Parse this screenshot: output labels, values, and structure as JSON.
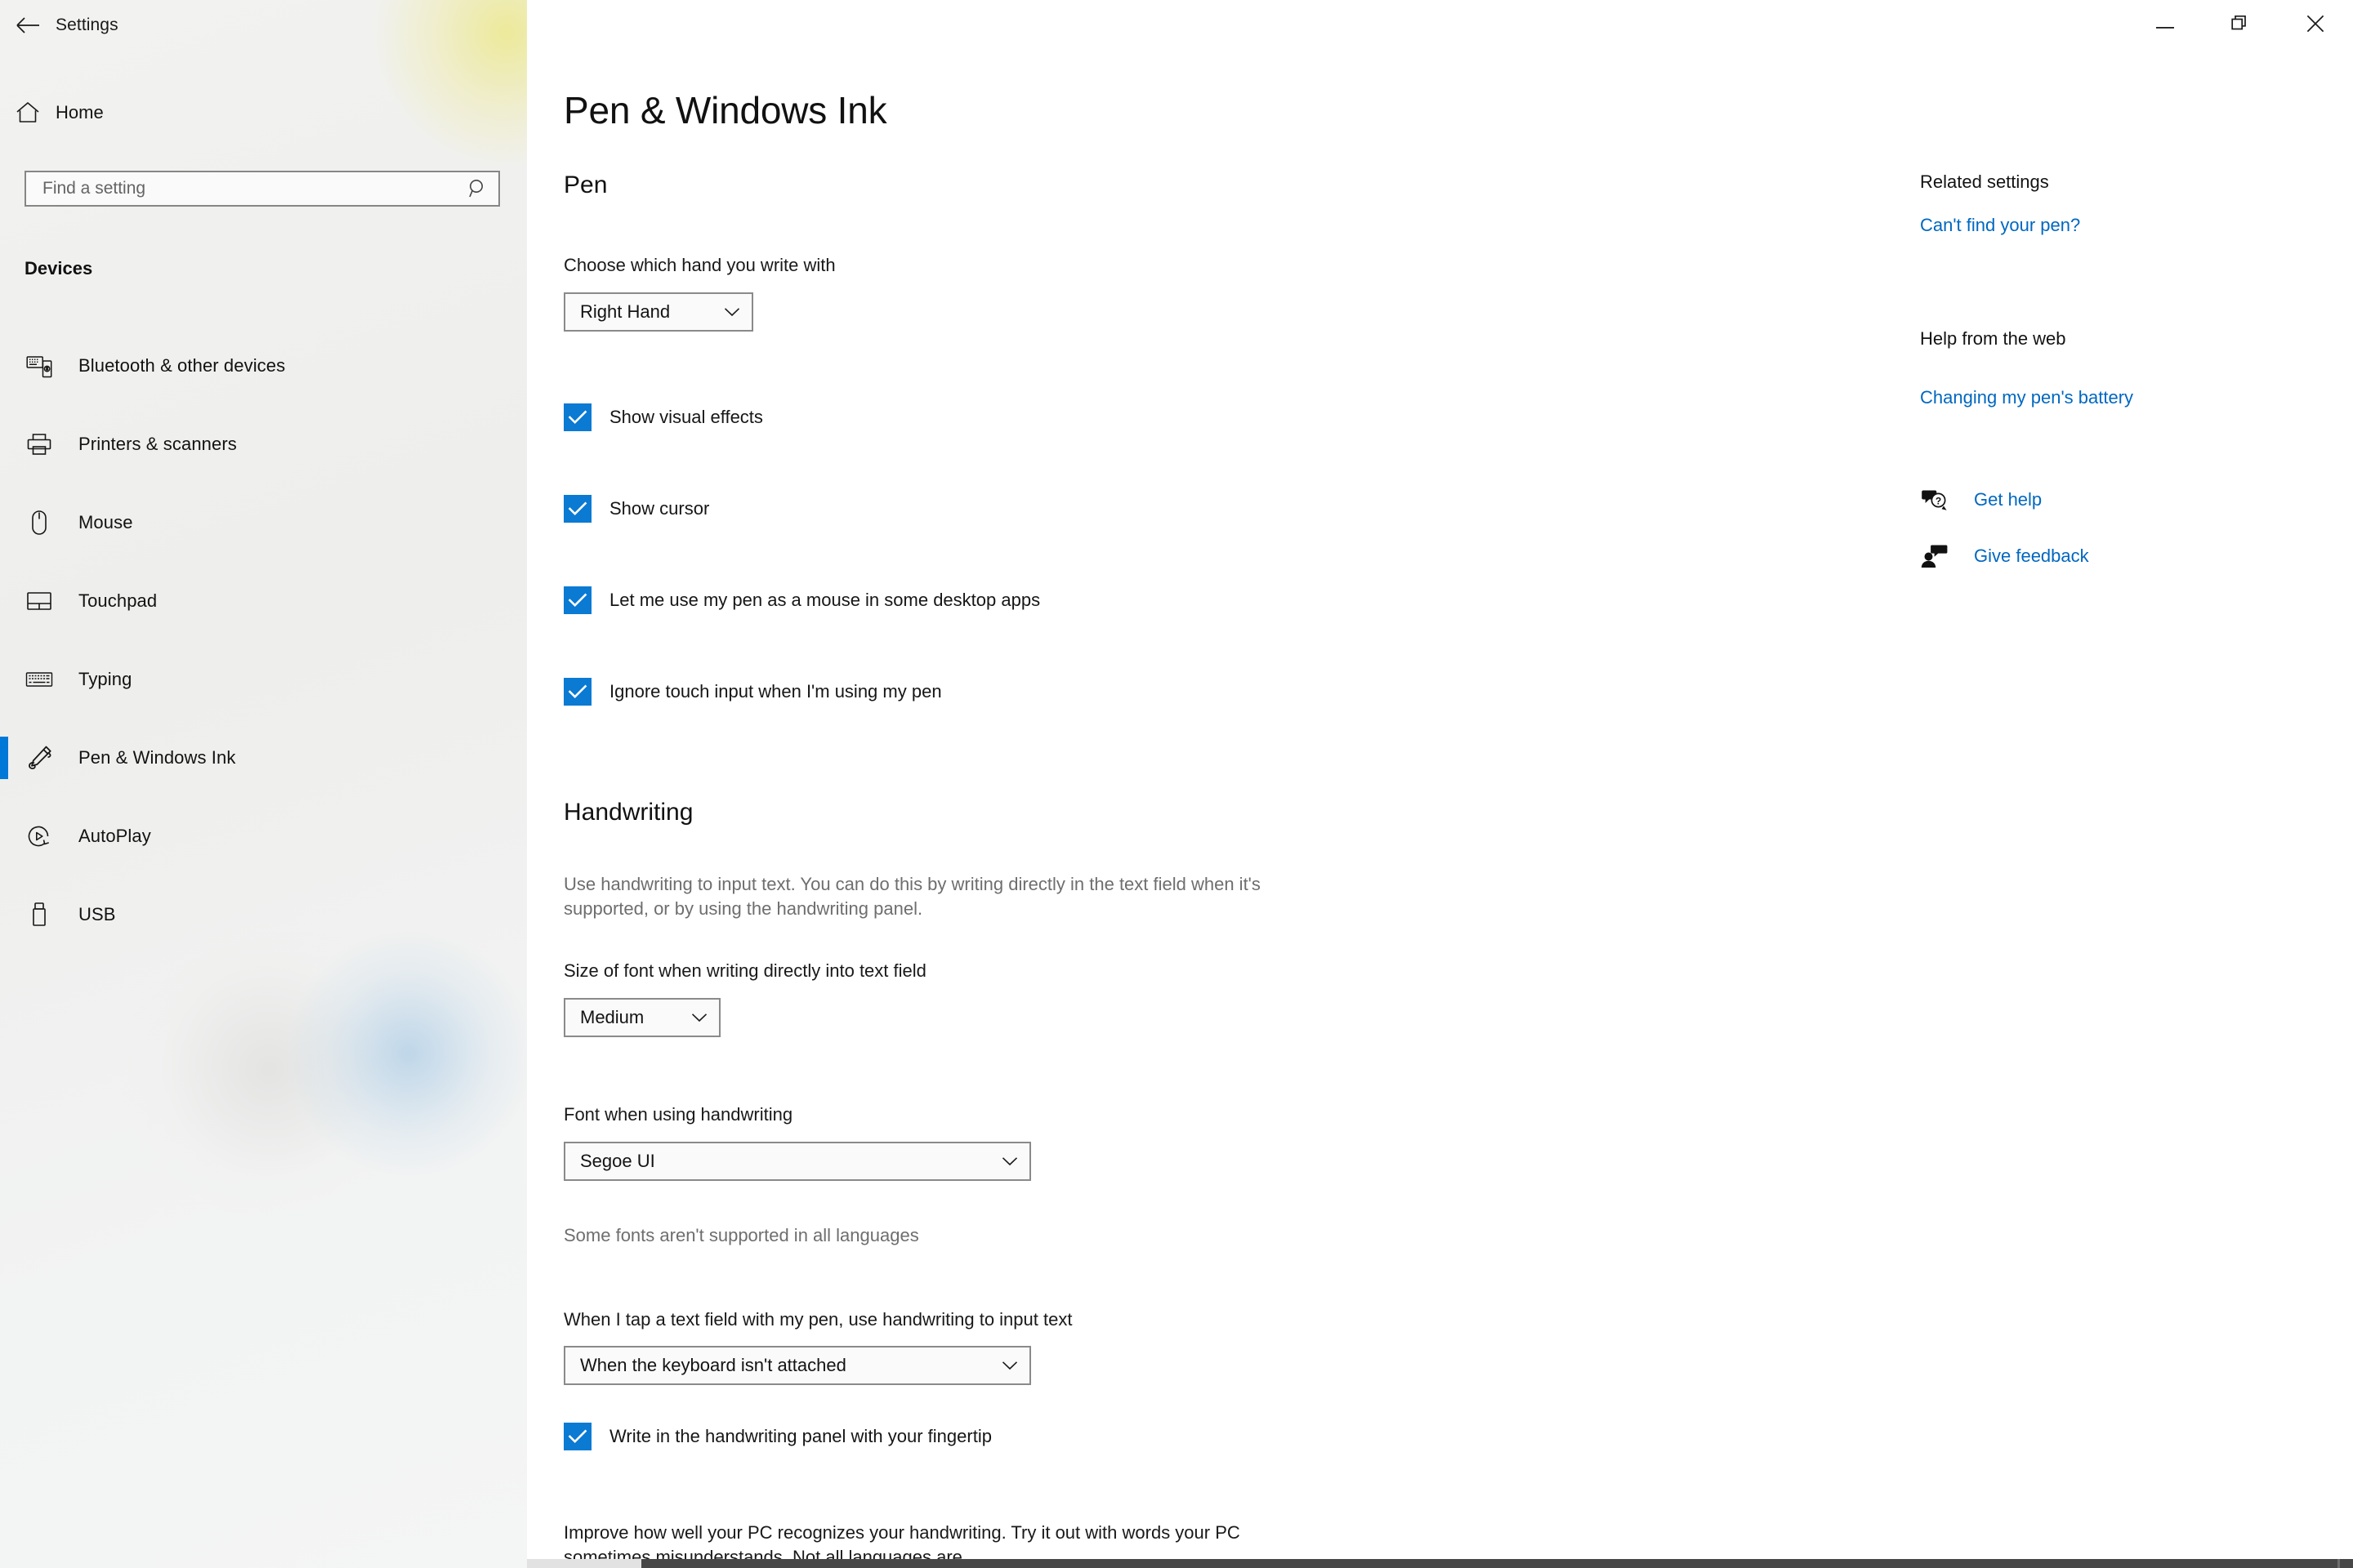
{
  "window": {
    "title": "Settings",
    "back_icon": "back-arrow-icon",
    "controls": {
      "minimize": "minimize-icon",
      "maximize": "maximize-restore-icon",
      "close": "close-icon"
    }
  },
  "sidebar": {
    "home_label": "Home",
    "home_icon": "home-icon",
    "search": {
      "placeholder": "Find a setting",
      "value": "",
      "icon": "search-icon"
    },
    "category_heading": "Devices",
    "accent_color": "#0078d7",
    "items": [
      {
        "label": "Bluetooth & other devices",
        "icon": "bluetooth-devices-icon",
        "selected": false
      },
      {
        "label": "Printers & scanners",
        "icon": "printer-icon",
        "selected": false
      },
      {
        "label": "Mouse",
        "icon": "mouse-icon",
        "selected": false
      },
      {
        "label": "Touchpad",
        "icon": "touchpad-icon",
        "selected": false
      },
      {
        "label": "Typing",
        "icon": "keyboard-icon",
        "selected": false
      },
      {
        "label": "Pen & Windows Ink",
        "icon": "pen-icon",
        "selected": true
      },
      {
        "label": "AutoPlay",
        "icon": "autoplay-icon",
        "selected": false
      },
      {
        "label": "USB",
        "icon": "usb-icon",
        "selected": false
      }
    ]
  },
  "main": {
    "page_title": "Pen & Windows Ink",
    "pen": {
      "heading": "Pen",
      "hand_label": "Choose which hand you write with",
      "hand_value": "Right Hand",
      "checkboxes": [
        {
          "label": "Show visual effects",
          "checked": true
        },
        {
          "label": "Show cursor",
          "checked": true
        },
        {
          "label": "Let me use my pen as a mouse in some desktop apps",
          "checked": true
        },
        {
          "label": "Ignore touch input when I'm using my pen",
          "checked": true
        }
      ]
    },
    "handwriting": {
      "heading": "Handwriting",
      "description": "Use handwriting to input text. You can do this by writing directly in the text field when it's supported, or by using the handwriting panel.",
      "font_size_label": "Size of font when writing directly into text field",
      "font_size_value": "Medium",
      "font_label": "Font when using handwriting",
      "font_value": "Segoe UI",
      "font_note": "Some fonts aren't supported in all languages",
      "tap_label": "When I tap a text field with my pen, use handwriting to input text",
      "tap_value": "When the keyboard isn't attached",
      "fingertip_checkbox": {
        "label": "Write in the handwriting panel with your fingertip",
        "checked": true
      },
      "improve_text": "Improve how well your PC recognizes your handwriting. Try it out with words your PC sometimes misunderstands. Not all languages are"
    }
  },
  "right_pane": {
    "related_heading": "Related settings",
    "related_link": "Can't find your pen?",
    "help_heading": "Help from the web",
    "help_link": "Changing my pen's battery",
    "get_help": {
      "label": "Get help",
      "icon": "question-bubble-icon"
    },
    "give_feedback": {
      "label": "Give feedback",
      "icon": "feedback-person-icon"
    },
    "link_color": "#0067c0"
  }
}
